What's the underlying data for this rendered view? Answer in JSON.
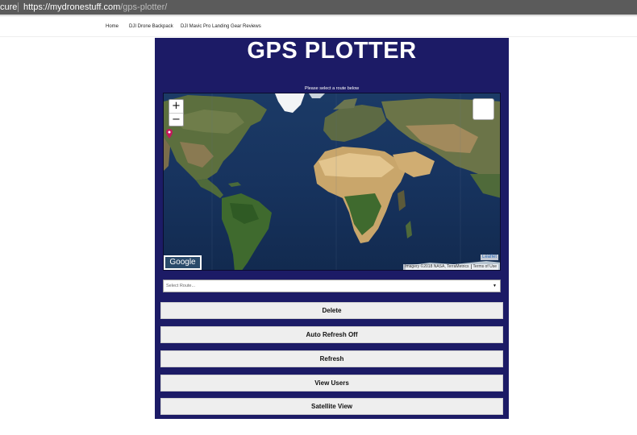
{
  "browser": {
    "secure_label": "cure",
    "url_host": "https://mydronestuff.com",
    "url_path": "/gps-plotter/"
  },
  "nav": {
    "items": [
      {
        "label": "Home"
      },
      {
        "label": "DJI Drone Backpack"
      },
      {
        "label": "DJI Mavic Pro Landing Gear Reviews"
      }
    ]
  },
  "panel": {
    "title": "GPS PLOTTER",
    "subtitle": "Please select a route below",
    "background_color": "#1c1b66"
  },
  "map": {
    "zoom_in": "+",
    "zoom_out": "−",
    "google_logo": "Google",
    "leaflet": "Leaflet",
    "imagery": "Imagery ©2018 NASA, TerraMetrics",
    "terms": "Terms of Use",
    "marker_color": "#c2185b"
  },
  "route_select": {
    "selected": "Select Route...",
    "arrow": "▼"
  },
  "buttons": {
    "delete": "Delete",
    "auto_refresh": "Auto Refresh Off",
    "refresh": "Refresh",
    "view_users": "View Users",
    "satellite_view": "Satellite View"
  }
}
